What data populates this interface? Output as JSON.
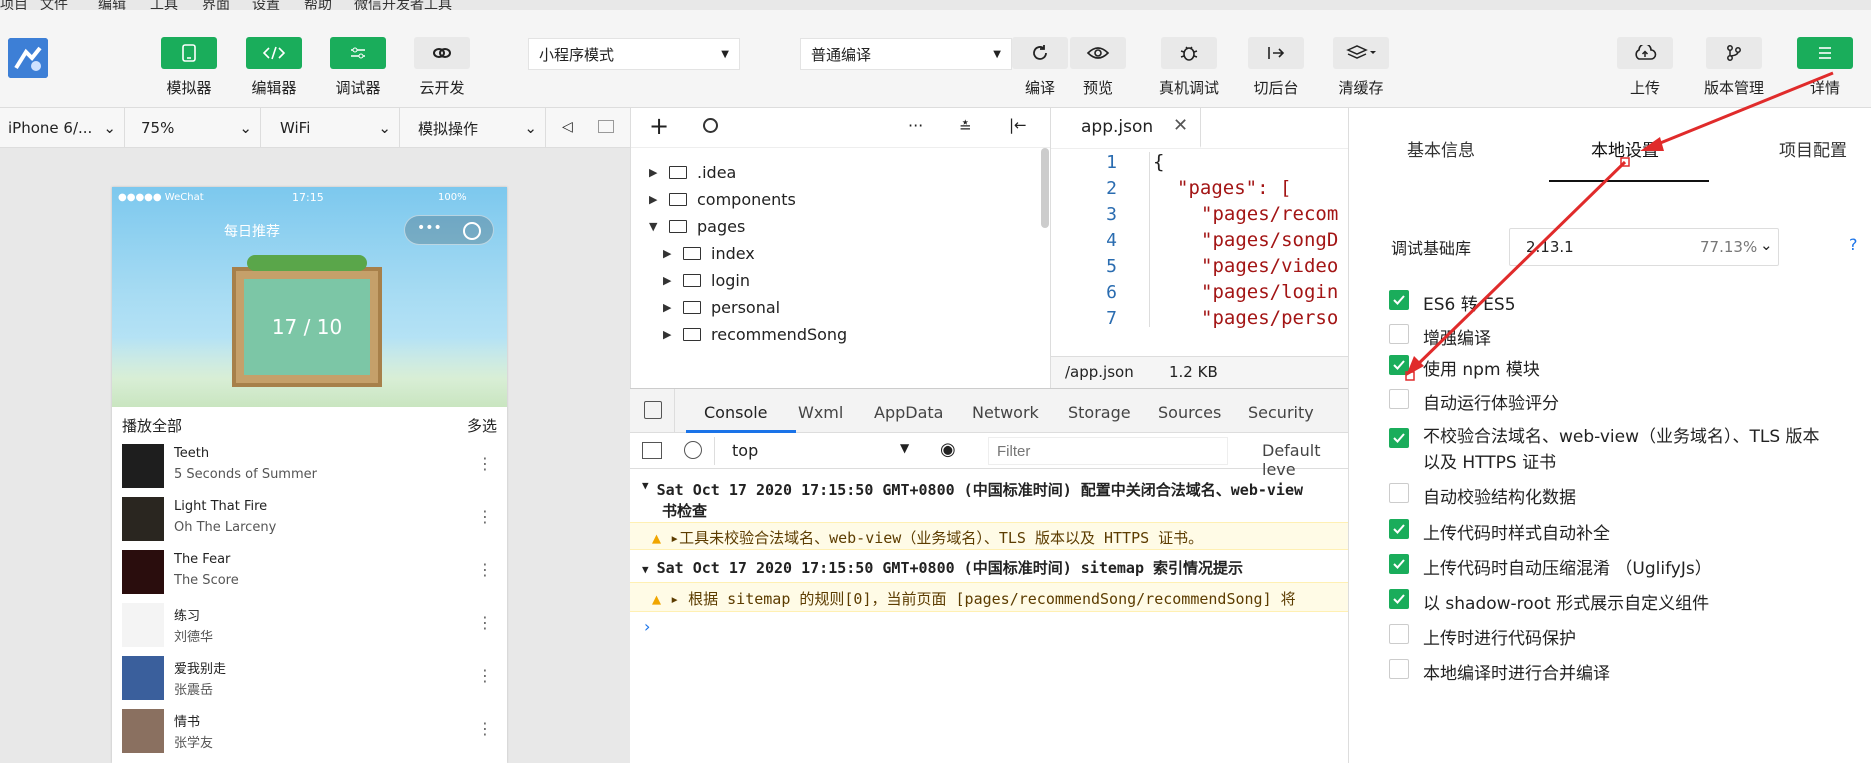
{
  "menu": [
    "项目",
    "文件",
    "编辑",
    "工具",
    "界面",
    "设置",
    "帮助",
    "微信开发者工具"
  ],
  "toolbar": {
    "left_buttons": [
      "模拟器",
      "编辑器",
      "调试器",
      "云开发"
    ],
    "mode_select": "小程序模式",
    "compile_select": "普通编译",
    "mid_buttons": [
      "编译",
      "预览",
      "真机调试",
      "切后台",
      "清缓存"
    ],
    "right_buttons": [
      "上传",
      "版本管理",
      "详情"
    ]
  },
  "subbar": {
    "device": "iPhone 6/...",
    "zoom": "75%",
    "network": "WiFi",
    "operation": "模拟操作"
  },
  "phone": {
    "status_left": "●●●●● WeChat",
    "status_time": "17:15",
    "status_right": "100%",
    "title": "每日推荐",
    "date": "17 / 10",
    "play_all": "播放全部",
    "multi": "多选",
    "songs": [
      {
        "title": "Teeth",
        "artist": "5 Seconds of Summer"
      },
      {
        "title": "Light That Fire",
        "artist": "Oh The Larceny"
      },
      {
        "title": "The Fear",
        "artist": "The Score"
      },
      {
        "title": "练习",
        "artist": "刘德华"
      },
      {
        "title": "爱我别走",
        "artist": "张震岳"
      },
      {
        "title": "情书",
        "artist": "张学友"
      }
    ]
  },
  "filetree": [
    ".idea",
    "components",
    "pages",
    "index",
    "login",
    "personal",
    "recommendSong"
  ],
  "editor": {
    "tab": "app.json",
    "lines": [
      "1",
      "2",
      "3",
      "4",
      "5",
      "6",
      "7"
    ],
    "code": [
      "{",
      "\"pages\": [",
      "\"pages/recom",
      "\"pages/songD",
      "\"pages/video",
      "\"pages/login",
      "\"pages/perso"
    ],
    "footer_path": "/app.json",
    "footer_size": "1.2 KB"
  },
  "console": {
    "tabs": [
      "Console",
      "Wxml",
      "AppData",
      "Network",
      "Storage",
      "Sources",
      "Security"
    ],
    "context": "top",
    "filter_placeholder": "Filter",
    "levels": "Default leve",
    "log1_head": "Sat Oct 17 2020 17:15:50 GMT+0800 (中国标准时间) 配置中关闭合法域名、web-view",
    "log1_cont": "书检查",
    "warn1": "▸工具未校验合法域名、web-view（业务域名）、TLS 版本以及 HTTPS 证书。",
    "log2_head": "Sat Oct 17 2020 17:15:50 GMT+0800 (中国标准时间) sitemap 索引情况提示",
    "warn2": "▸ 根据 sitemap 的规则[0]，当前页面 [pages/recommendSong/recommendSong] 将"
  },
  "details": {
    "tabs": [
      "基本信息",
      "本地设置",
      "项目配置"
    ],
    "lib_label": "调试基础库",
    "lib_version": "2.13.1",
    "lib_percent": "77.13%",
    "help": "?",
    "options": [
      {
        "label": "ES6 转 ES5",
        "checked": true
      },
      {
        "label": "增强编译",
        "checked": false
      },
      {
        "label": "使用 npm 模块",
        "checked": true
      },
      {
        "label": "自动运行体验评分",
        "checked": false
      },
      {
        "label": "不校验合法域名、web-view（业务域名）、TLS 版本以及 HTTPS 证书",
        "checked": true
      },
      {
        "label": "自动校验结构化数据",
        "checked": false
      },
      {
        "label": "上传代码时样式自动补全",
        "checked": true
      },
      {
        "label": "上传代码时自动压缩混淆 （UglifyJs）",
        "checked": true
      },
      {
        "label": "以 shadow-root 形式展示自定义组件",
        "checked": true
      },
      {
        "label": "上传时进行代码保护",
        "checked": false
      },
      {
        "label": "本地编译时进行合并编译",
        "checked": false
      }
    ]
  },
  "colors": {
    "accent": "#1aad5b",
    "arrow": "#e02b2b"
  }
}
